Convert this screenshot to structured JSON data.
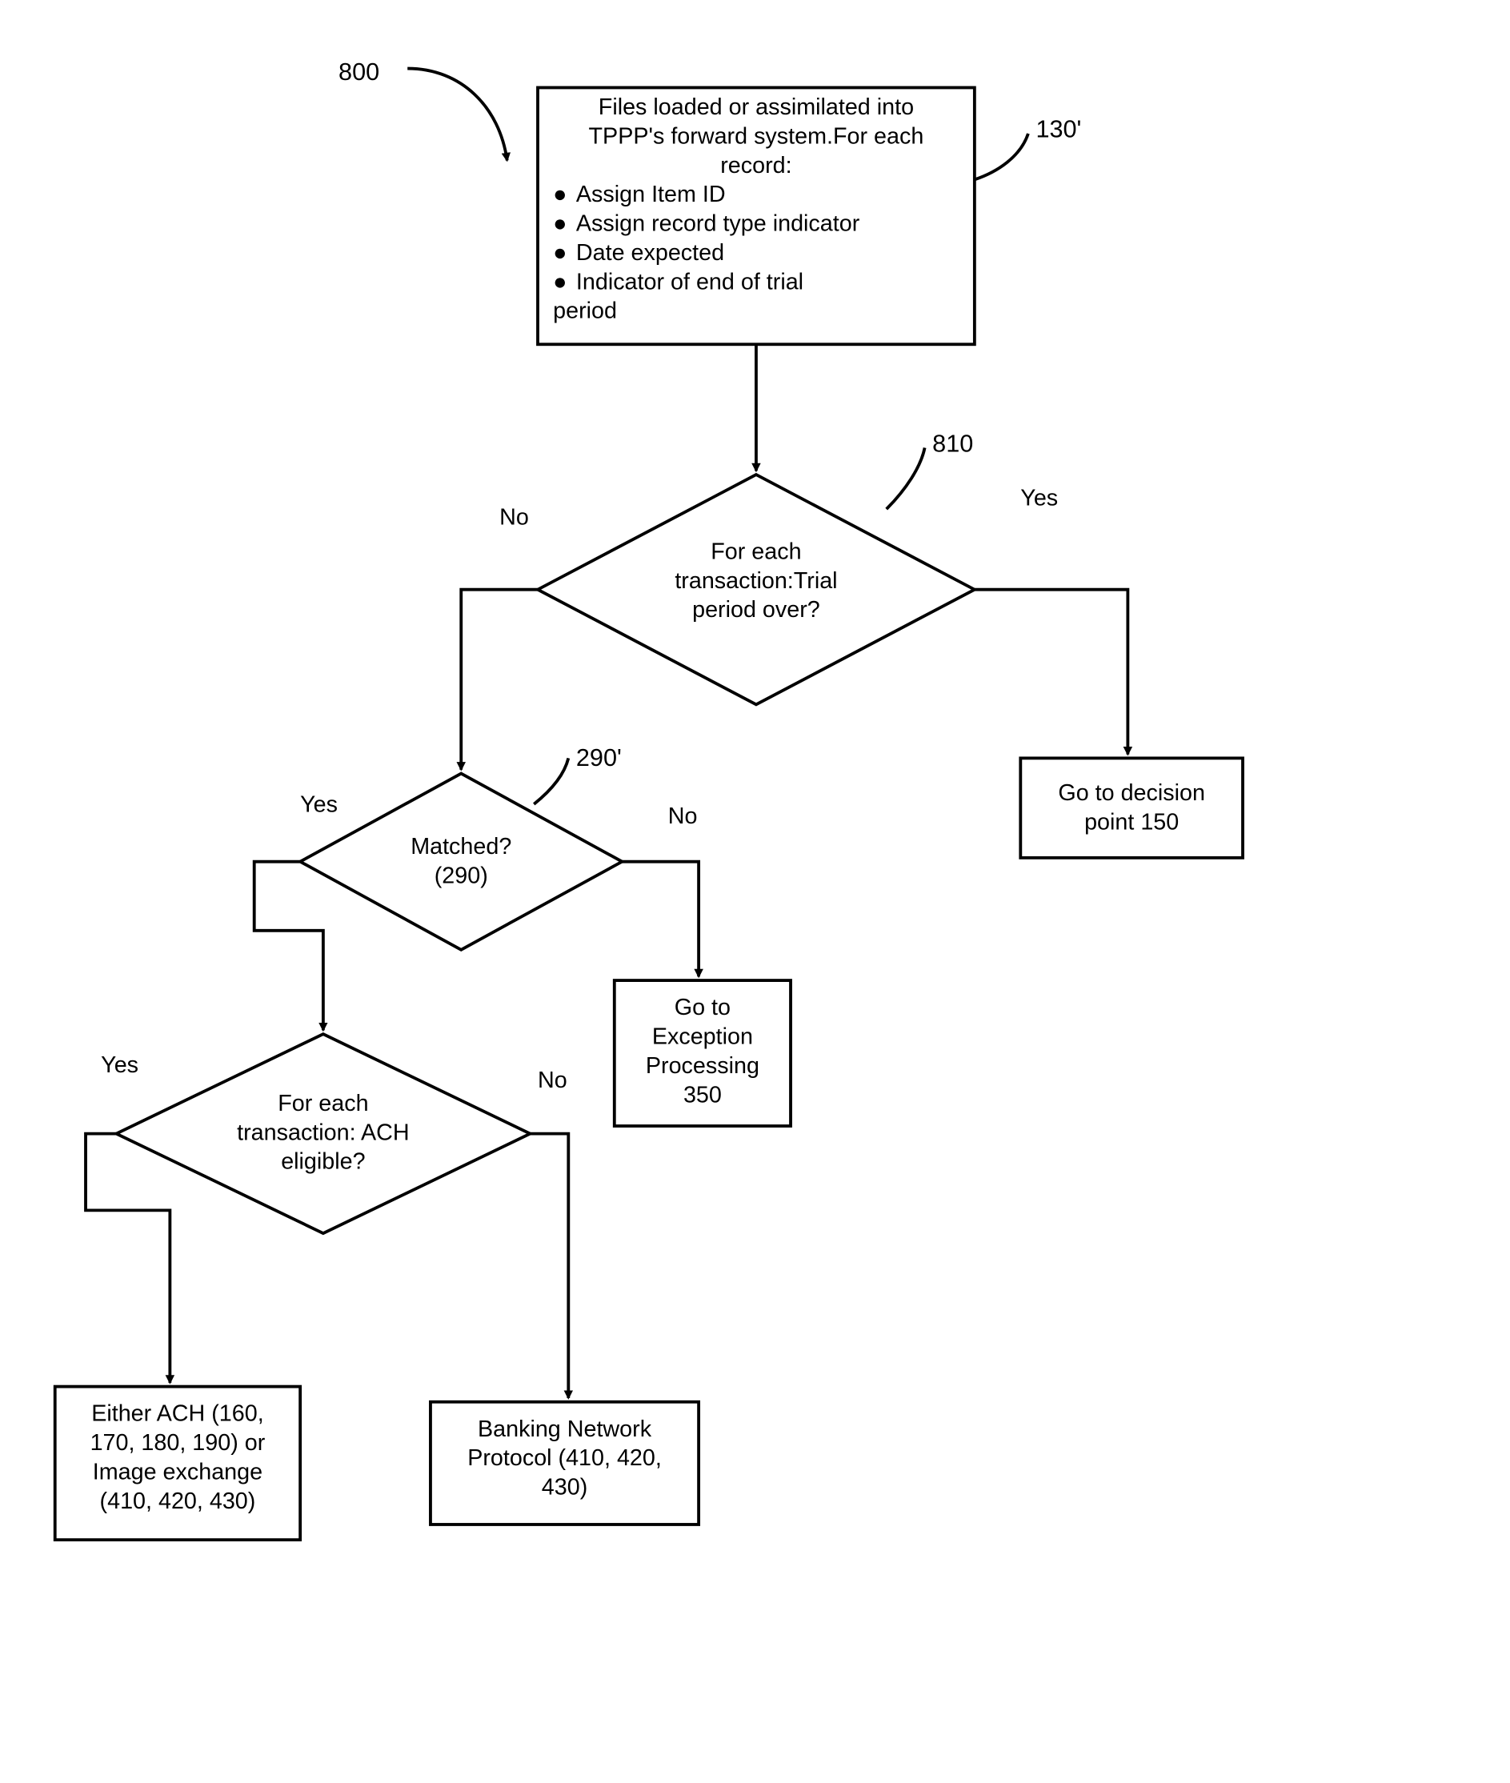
{
  "figureLabel": "800",
  "nodes": {
    "n130": {
      "ref": "130'",
      "title1": "Files loaded or assimilated into",
      "title2": "TPPP's forward system.For each",
      "title3": "record:",
      "b1": "Assign Item ID",
      "b2": "Assign record type indicator",
      "b3": "Date expected",
      "b4a": "Indicator of end of trial",
      "b4b": "period"
    },
    "d810": {
      "ref": "810",
      "l1": "For each",
      "l2": "transaction:Trial",
      "l3": "period over?"
    },
    "d290": {
      "ref": "290'",
      "l1": "Matched?",
      "l2": "(290)"
    },
    "dACH": {
      "l1": "For each",
      "l2": "transaction:  ACH",
      "l3": "eligible?"
    },
    "box150": {
      "l1": "Go to decision",
      "l2": "point 150"
    },
    "box350": {
      "l1": "Go to",
      "l2": "Exception",
      "l3": "Processing",
      "l4": "350"
    },
    "boxEither": {
      "l1": "Either ACH (160,",
      "l2": "170, 180, 190) or",
      "l3": "Image exchange",
      "l4": "(410, 420, 430)"
    },
    "boxBNP": {
      "l1": "Banking Network",
      "l2": "Protocol (410, 420,",
      "l3": "430)"
    }
  },
  "edges": {
    "yes": "Yes",
    "no": "No"
  }
}
